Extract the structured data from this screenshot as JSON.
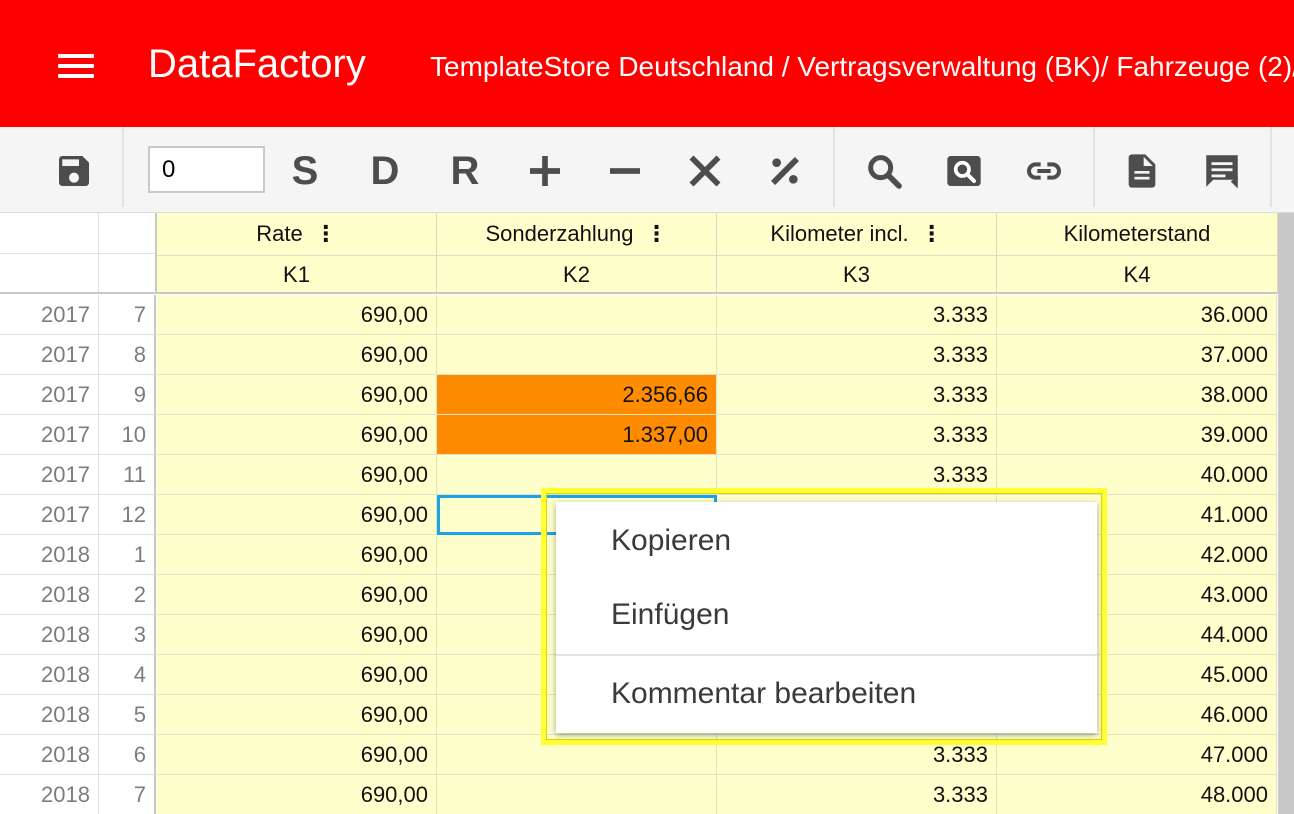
{
  "header": {
    "app_title": "DataFactory",
    "breadcrumb": "TemplateStore Deutschland / Vertragsverwaltung (BK)/ Fahrzeuge (2)/",
    "menu_icon": "hamburger-menu-icon"
  },
  "toolbar": {
    "zoom_value": "0",
    "save_icon": "save-disk-icon",
    "letters": [
      "S",
      "D",
      "R"
    ],
    "icons": [
      "plus-icon",
      "minus-icon",
      "close-icon",
      "percent-icon",
      "search-icon",
      "search-box-icon",
      "link-icon",
      "document-icon",
      "comment-icon"
    ]
  },
  "columns": [
    {
      "name": "Rate",
      "code": "K1",
      "has_menu": true
    },
    {
      "name": "Sonderzahlung",
      "code": "K2",
      "has_menu": true
    },
    {
      "name": "Kilometer incl.",
      "code": "K3",
      "has_menu": true
    },
    {
      "name": "Kilometerstand",
      "code": "K4",
      "has_menu": false
    }
  ],
  "column_menu_glyph": "⋮",
  "rows": [
    {
      "year": "2017",
      "month": "7",
      "k1": "690,00",
      "k2": "",
      "k3": "3.333",
      "k4": "36.000"
    },
    {
      "year": "2017",
      "month": "8",
      "k1": "690,00",
      "k2": "",
      "k3": "3.333",
      "k4": "37.000"
    },
    {
      "year": "2017",
      "month": "9",
      "k1": "690,00",
      "k2": "2.356,66",
      "k3": "3.333",
      "k4": "38.000"
    },
    {
      "year": "2017",
      "month": "10",
      "k1": "690,00",
      "k2": "1.337,00",
      "k3": "3.333",
      "k4": "39.000"
    },
    {
      "year": "2017",
      "month": "11",
      "k1": "690,00",
      "k2": "",
      "k3": "3.333",
      "k4": "40.000"
    },
    {
      "year": "2017",
      "month": "12",
      "k1": "690,00",
      "k2": "",
      "k3": "",
      "k4": "41.000"
    },
    {
      "year": "2018",
      "month": "1",
      "k1": "690,00",
      "k2": "",
      "k3": "",
      "k4": "42.000"
    },
    {
      "year": "2018",
      "month": "2",
      "k1": "690,00",
      "k2": "",
      "k3": "",
      "k4": "43.000"
    },
    {
      "year": "2018",
      "month": "3",
      "k1": "690,00",
      "k2": "",
      "k3": "",
      "k4": "44.000"
    },
    {
      "year": "2018",
      "month": "4",
      "k1": "690,00",
      "k2": "",
      "k3": "",
      "k4": "45.000"
    },
    {
      "year": "2018",
      "month": "5",
      "k1": "690,00",
      "k2": "",
      "k3": "",
      "k4": "46.000"
    },
    {
      "year": "2018",
      "month": "6",
      "k1": "690,00",
      "k2": "",
      "k3": "3.333",
      "k4": "47.000"
    },
    {
      "year": "2018",
      "month": "7",
      "k1": "690,00",
      "k2": "",
      "k3": "3.333",
      "k4": "48.000"
    }
  ],
  "highlighted_k2_rows": [
    2,
    3
  ],
  "selected_cell": {
    "row": 5,
    "column": "K2"
  },
  "context_menu": {
    "items": [
      "Kopieren",
      "Einfügen",
      "Kommentar bearbeiten"
    ]
  },
  "colors": {
    "header_bg": "#ff0000",
    "grid_bg": "#ffffcc",
    "highlight": "#ff8c00",
    "selection": "#1aa3e8",
    "callout": "#ffff33"
  }
}
